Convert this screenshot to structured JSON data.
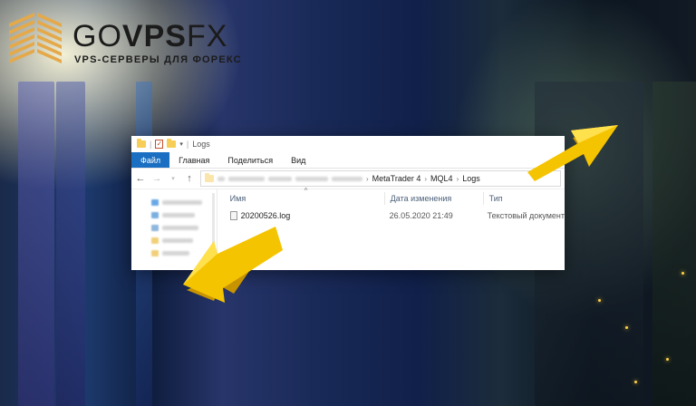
{
  "logo": {
    "brand_prefix": "GO",
    "brand_bold": "VPS",
    "brand_suffix": "FX",
    "tagline": "VPS-СЕРВЕРЫ ДЛЯ ФОРЕКС",
    "icon": "building-stripes-logo"
  },
  "window": {
    "title": "Logs",
    "ribbon_tabs": [
      "Файл",
      "Главная",
      "Поделиться",
      "Вид"
    ],
    "breadcrumb": [
      "MetaTrader 4",
      "MQL4",
      "Logs"
    ],
    "columns": {
      "name": "Имя",
      "date": "Дата изменения",
      "type": "Тип"
    },
    "files": [
      {
        "name": "20200526.log",
        "date": "26.05.2020 21:49",
        "type": "Текстовый документ"
      }
    ]
  },
  "colors": {
    "accent": "#1a6fc2",
    "arrow_yellow": "#f5c400",
    "logo_gold": "#e5a94a"
  }
}
